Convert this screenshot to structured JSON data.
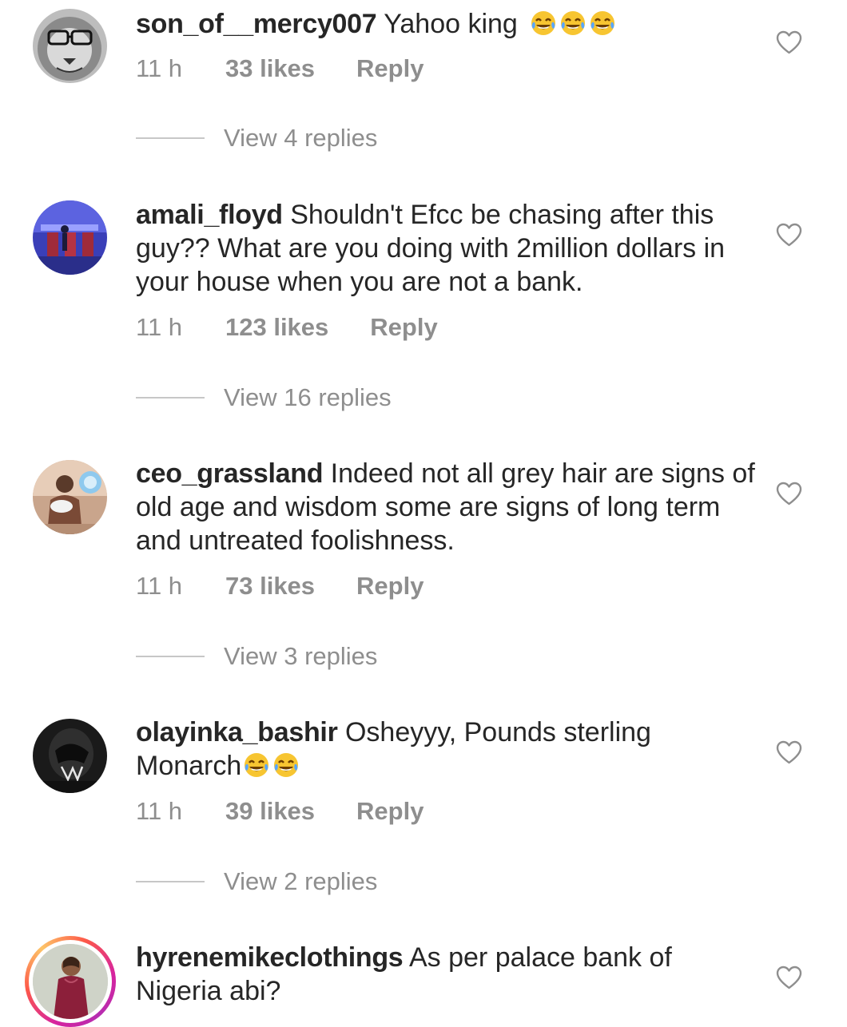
{
  "comments": [
    {
      "username": "son_of__mercy007",
      "text": "Yahoo king",
      "emojis": "😂😂😂",
      "time": "11 h",
      "likes": "33 likes",
      "reply": "Reply",
      "view_replies": "View 4 replies"
    },
    {
      "username": "amali_floyd",
      "text": "Shouldn't Efcc be chasing after this guy?? What are you doing with 2million dollars in your house when you are not a bank.",
      "time": "11 h",
      "likes": "123 likes",
      "reply": "Reply",
      "view_replies": "View 16 replies"
    },
    {
      "username": "ceo_grassland",
      "text": "Indeed not all grey hair are signs of old age and wisdom some are signs of long term and untreated foolishness.",
      "time": "11 h",
      "likes": "73 likes",
      "reply": "Reply",
      "view_replies": "View 3 replies"
    },
    {
      "username": "olayinka_bashir",
      "text": "Osheyyy, Pounds sterling Monarch",
      "emojis": "😂😂",
      "time": "11 h",
      "likes": "39 likes",
      "reply": "Reply",
      "view_replies": "View 2 replies"
    },
    {
      "username": "hyrenemikeclothings",
      "text": "As per palace bank of Nigeria abi?"
    }
  ],
  "icons": {
    "like": "heart-outline-icon",
    "emoji": "face-with-tears-of-joy-emoji"
  },
  "colors": {
    "text_primary": "#262626",
    "text_secondary": "#8e8e8e",
    "story_ring": "#d6249f"
  }
}
